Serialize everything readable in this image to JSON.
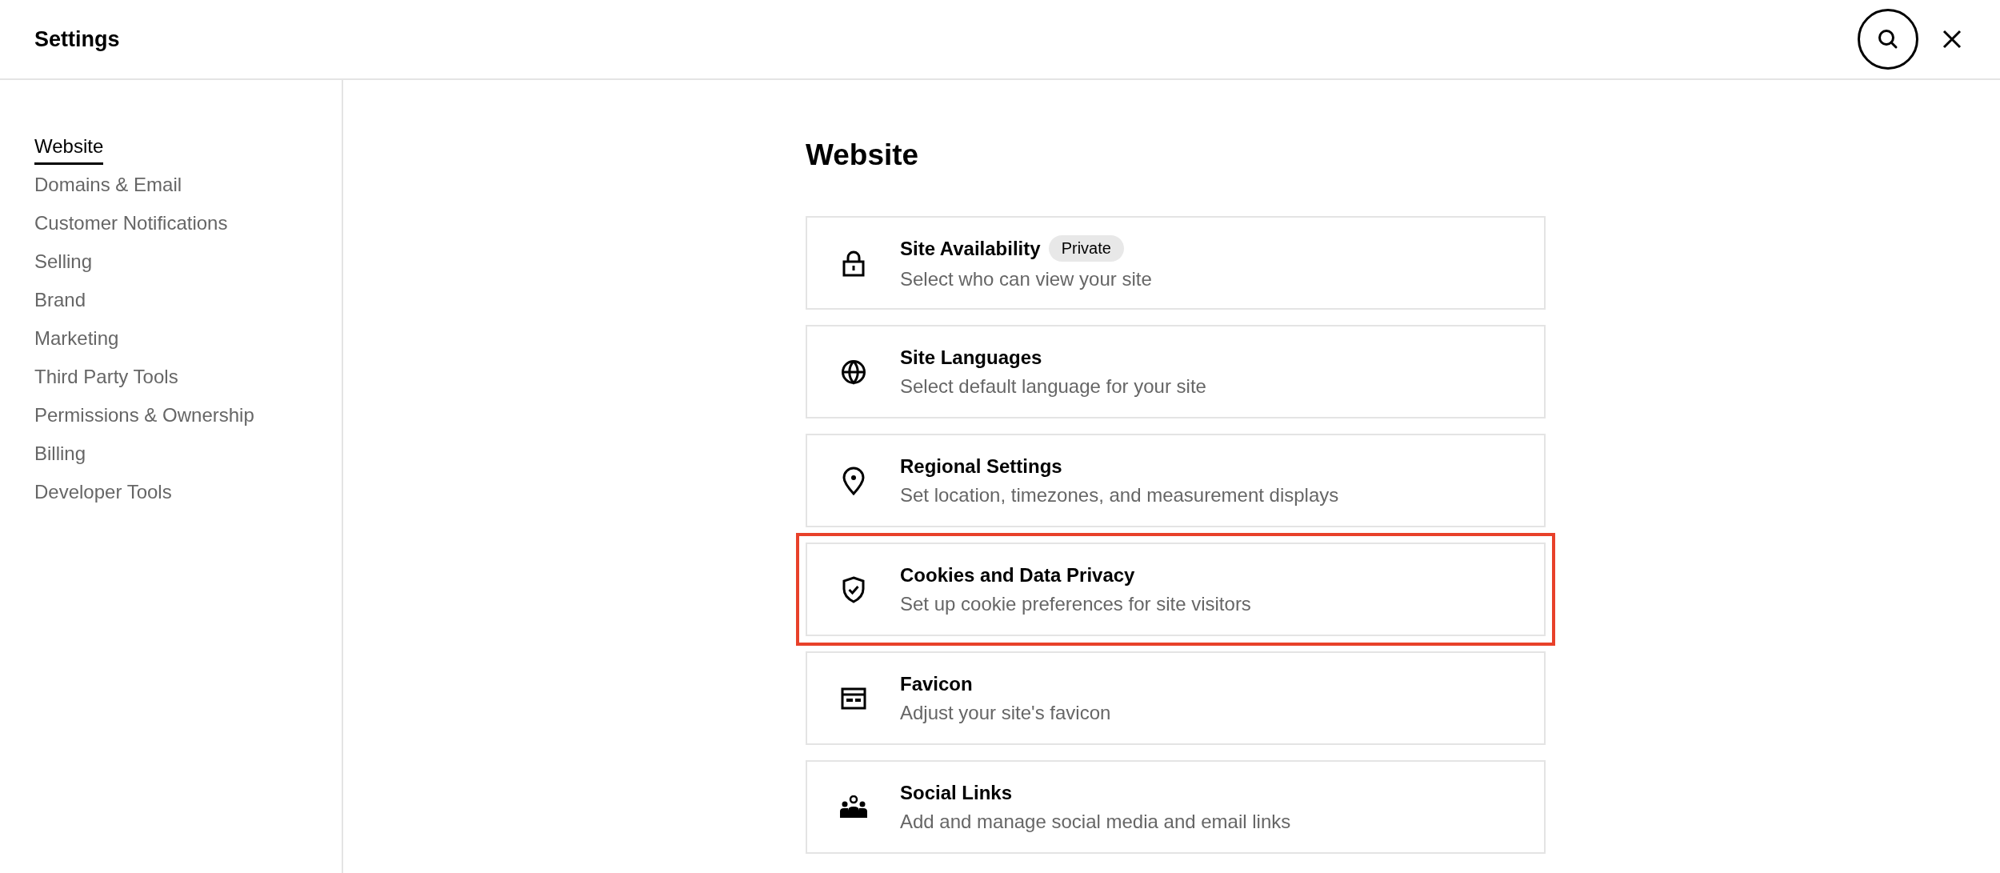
{
  "header": {
    "title": "Settings"
  },
  "sidebar": {
    "items": [
      {
        "label": "Website",
        "selected": true
      },
      {
        "label": "Domains & Email",
        "selected": false
      },
      {
        "label": "Customer Notifications",
        "selected": false
      },
      {
        "label": "Selling",
        "selected": false
      },
      {
        "label": "Brand",
        "selected": false
      },
      {
        "label": "Marketing",
        "selected": false
      },
      {
        "label": "Third Party Tools",
        "selected": false
      },
      {
        "label": "Permissions & Ownership",
        "selected": false
      },
      {
        "label": "Billing",
        "selected": false
      },
      {
        "label": "Developer Tools",
        "selected": false
      }
    ]
  },
  "main": {
    "heading": "Website",
    "cards": [
      {
        "kind": "lock",
        "title": "Site Availability",
        "badge": "Private",
        "description": "Select who can view your site",
        "highlighted": false
      },
      {
        "kind": "globe",
        "title": "Site Languages",
        "description": "Select default language for your site",
        "highlighted": false
      },
      {
        "kind": "pin",
        "title": "Regional Settings",
        "description": "Set location, timezones, and measurement displays",
        "highlighted": false
      },
      {
        "kind": "shield",
        "title": "Cookies and Data Privacy",
        "description": "Set up cookie preferences for site visitors",
        "highlighted": true
      },
      {
        "kind": "favicon",
        "title": "Favicon",
        "description": "Adjust your site's favicon",
        "highlighted": false
      },
      {
        "kind": "people",
        "title": "Social Links",
        "description": "Add and manage social media and email links",
        "highlighted": false
      }
    ]
  }
}
